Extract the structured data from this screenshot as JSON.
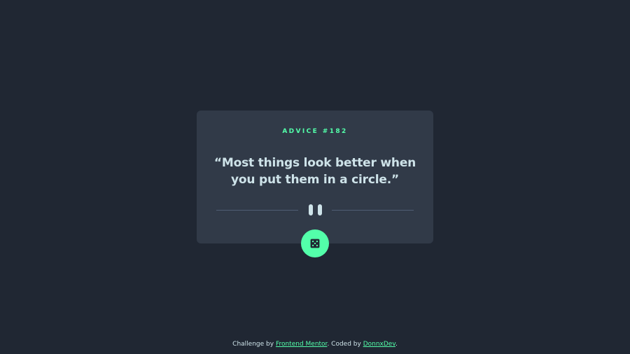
{
  "card": {
    "advice_id": "ADVICE #182",
    "advice_text": "“Most things look better when you put them in a circle.”"
  },
  "dice_button": {
    "icon": "dice-icon",
    "accent_color": "#53ffaa"
  },
  "footer": {
    "prefix": "Challenge by ",
    "challenge_link": "Frontend Mentor",
    "middle": ". Coded by ",
    "author_link": "DonnxDev",
    "suffix": "."
  },
  "colors": {
    "background": "#202733",
    "card": "#313a48",
    "accent": "#53ffaa",
    "text": "#cee3e9",
    "divider": "#4f5d74"
  }
}
